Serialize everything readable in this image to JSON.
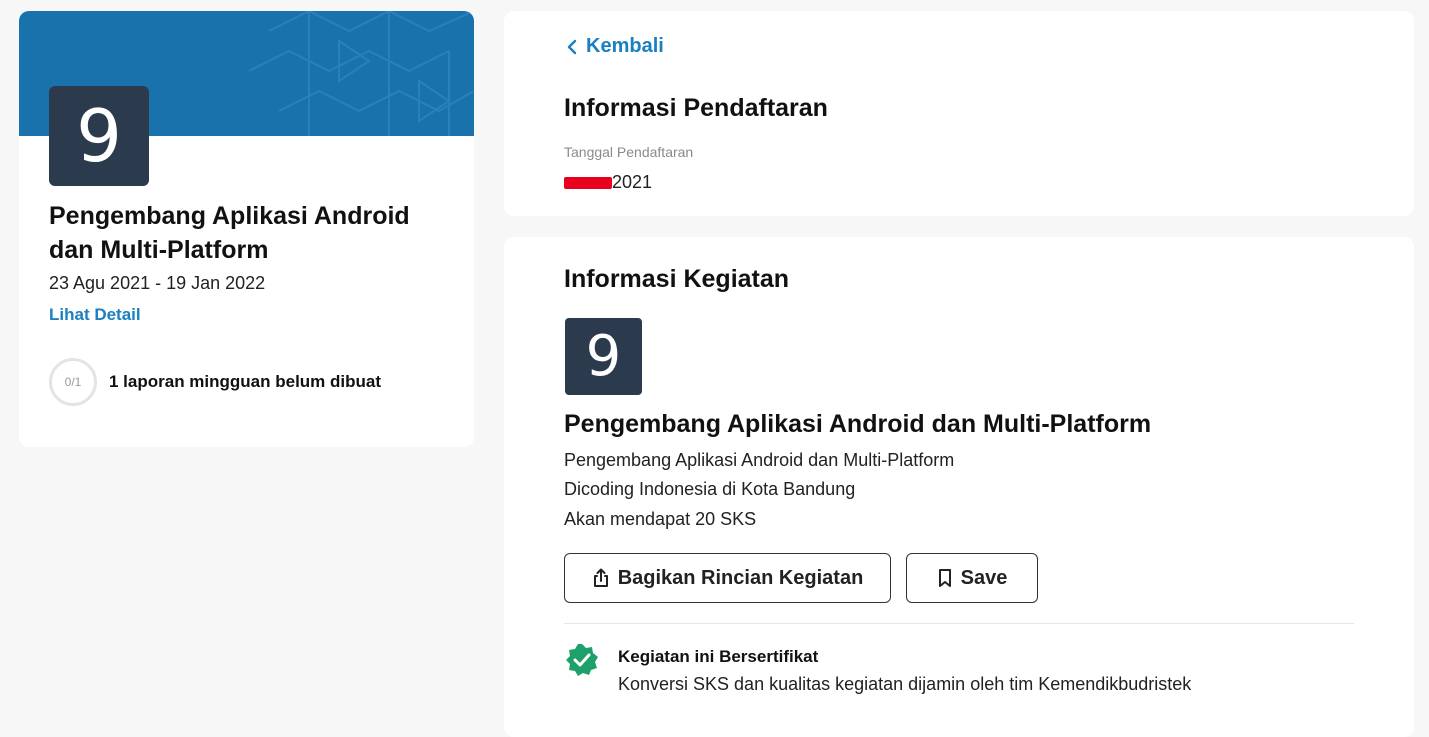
{
  "left_card": {
    "logo_char": "9",
    "title": "Pengembang Aplikasi Android dan Multi-Platform",
    "dates": "23 Agu 2021 - 19 Jan 2022",
    "detail_link": "Lihat Detail",
    "progress": "0/1",
    "progress_text": "1 laporan mingguan belum dibuat"
  },
  "registration": {
    "back_label": "Kembali",
    "heading": "Informasi Pendaftaran",
    "date_label": "Tanggal Pendaftaran",
    "date_value_visible": "2021"
  },
  "activity": {
    "heading": "Informasi Kegiatan",
    "logo_char": "9",
    "title": "Pengembang Aplikasi Android dan Multi-Platform",
    "subtitle": "Pengembang Aplikasi Android dan Multi-Platform",
    "organizer": "Dicoding Indonesia di Kota Bandung",
    "credits": "Akan mendapat 20 SKS",
    "share_button": "Bagikan Rincian Kegiatan",
    "save_button": "Save",
    "cert_title": "Kegiatan ini Bersertifikat",
    "cert_desc": "Konversi SKS dan kualitas kegiatan dijamin oleh tim Kemendikbudristek"
  },
  "colors": {
    "accent": "#1a80c2",
    "banner": "#1a72ad",
    "logo_bg": "#2c3a4e",
    "cert_green": "#1fa06a",
    "redaction": "#e8001c"
  },
  "icons": [
    "chevron-left-icon",
    "share-icon",
    "bookmark-icon",
    "verified-badge-icon"
  ]
}
